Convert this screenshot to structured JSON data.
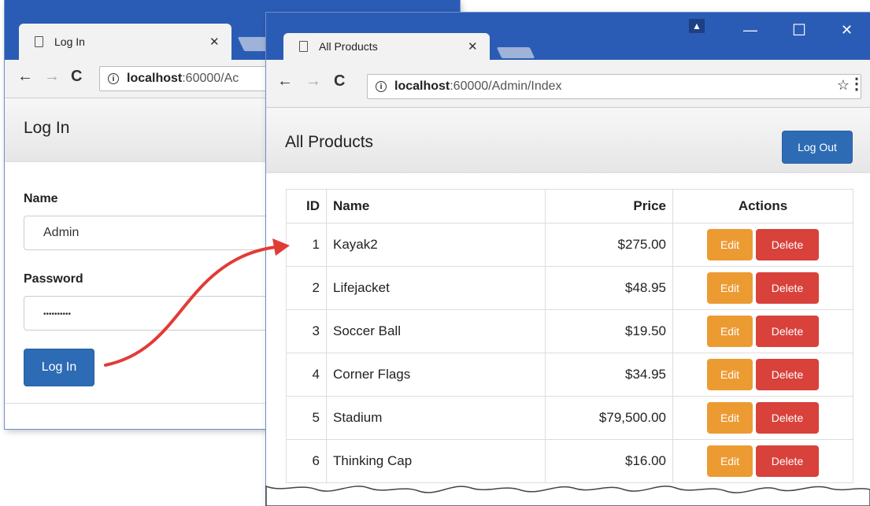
{
  "login_window": {
    "tab_title": "Log In",
    "url_host": "localhost",
    "url_rest": ":60000/Ac",
    "heading": "Log In",
    "name_label": "Name",
    "name_value": "Admin",
    "password_label": "Password",
    "password_value": "••••••••••",
    "login_button": "Log In"
  },
  "products_window": {
    "tab_title": "All Products",
    "url_host": "localhost",
    "url_rest": ":60000/Admin/Index",
    "heading": "All Products",
    "logout_button": "Log Out",
    "table": {
      "headers": {
        "id": "ID",
        "name": "Name",
        "price": "Price",
        "actions": "Actions"
      },
      "rows": [
        {
          "id": "1",
          "name": "Kayak2",
          "price": "$275.00"
        },
        {
          "id": "2",
          "name": "Lifejacket",
          "price": "$48.95"
        },
        {
          "id": "3",
          "name": "Soccer Ball",
          "price": "$19.50"
        },
        {
          "id": "4",
          "name": "Corner Flags",
          "price": "$34.95"
        },
        {
          "id": "5",
          "name": "Stadium",
          "price": "$79,500.00"
        },
        {
          "id": "6",
          "name": "Thinking Cap",
          "price": "$16.00"
        }
      ],
      "edit_label": "Edit",
      "delete_label": "Delete"
    }
  },
  "colors": {
    "titlebar": "#2b5cb5",
    "primary": "#2d6bb5",
    "edit": "#ec9b33",
    "delete": "#d9413b",
    "arrow": "#e23b36"
  }
}
